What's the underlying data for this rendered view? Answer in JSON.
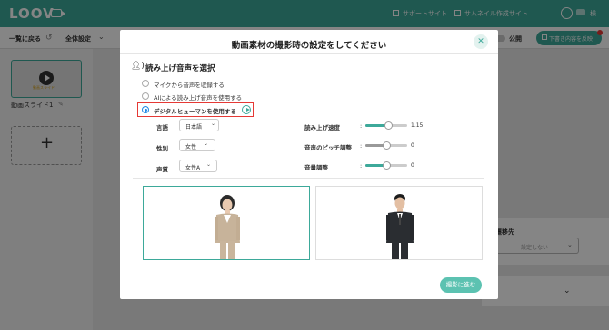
{
  "header": {
    "logo_text": "LOOV",
    "links": [
      "サポートサイト",
      "サムネイル作成サイト"
    ],
    "user_suffix": "様"
  },
  "toolbar": {
    "back_label": "一覧に戻る",
    "settings_label": "全体設定",
    "public_label": "公開",
    "request_label": "下書き内容を反映"
  },
  "sidebar": {
    "slide_label": "動画スライド1",
    "thumb_caption": "動画スライド"
  },
  "right_panel": {
    "transition_label": "遷移先",
    "transition_value": "設定しない"
  },
  "modal": {
    "title": "動画素材の撮影時の設定をしてください",
    "section_title": "読み上げ音声を選択",
    "radio_options": [
      {
        "label": "マイクから音声を収録する",
        "checked": false
      },
      {
        "label": "AIによる読み上げ音声を使用する",
        "checked": false
      },
      {
        "label": "デジタルヒューマンを使用する",
        "checked": true
      }
    ],
    "language": {
      "label": "言語",
      "value": "日本語"
    },
    "gender": {
      "label": "性別",
      "value": "女性"
    },
    "voice": {
      "label": "声質",
      "value": "女性A"
    },
    "sliders": [
      {
        "label": "読み上げ速度",
        "value": "1.15",
        "fraction": 0.55
      },
      {
        "label": "音声のピッチ調整",
        "value": "0",
        "fraction": 0.5
      },
      {
        "label": "音量調整",
        "value": "0",
        "fraction": 0.5
      }
    ],
    "next_button": "撮影に進む"
  }
}
